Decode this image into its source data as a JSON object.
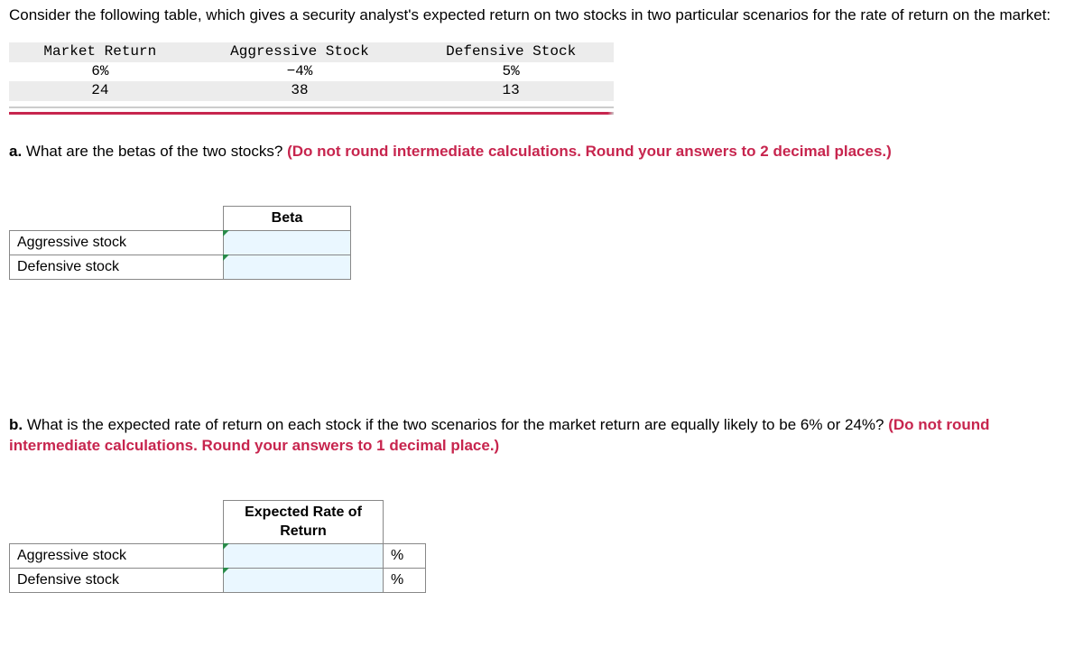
{
  "intro": "Consider the following table, which gives a security analyst's expected return on two stocks in two particular scenarios for the rate of return on the market:",
  "scenario_table": {
    "headers": [
      "Market Return",
      "Aggressive Stock",
      "Defensive Stock"
    ],
    "rows": [
      {
        "market": "6%",
        "aggressive": "−4%",
        "defensive": "5%"
      },
      {
        "market": "24",
        "aggressive": "38",
        "defensive": "13"
      }
    ]
  },
  "part_a": {
    "label": "a.",
    "question": " What are the betas of the two stocks? ",
    "hint": "(Do not round intermediate calculations. Round your answers to 2 decimal places.)",
    "col_header": "Beta",
    "row_labels": [
      "Aggressive stock",
      "Defensive stock"
    ]
  },
  "part_b": {
    "label": "b.",
    "question": " What is the expected rate of return on each stock if the two scenarios for the market return are equally likely to be 6% or 24%? ",
    "hint": "(Do not round intermediate calculations. Round your answers to 1 decimal place.)",
    "col_header": "Expected Rate of Return",
    "row_labels": [
      "Aggressive stock",
      "Defensive stock"
    ],
    "unit": "%"
  }
}
